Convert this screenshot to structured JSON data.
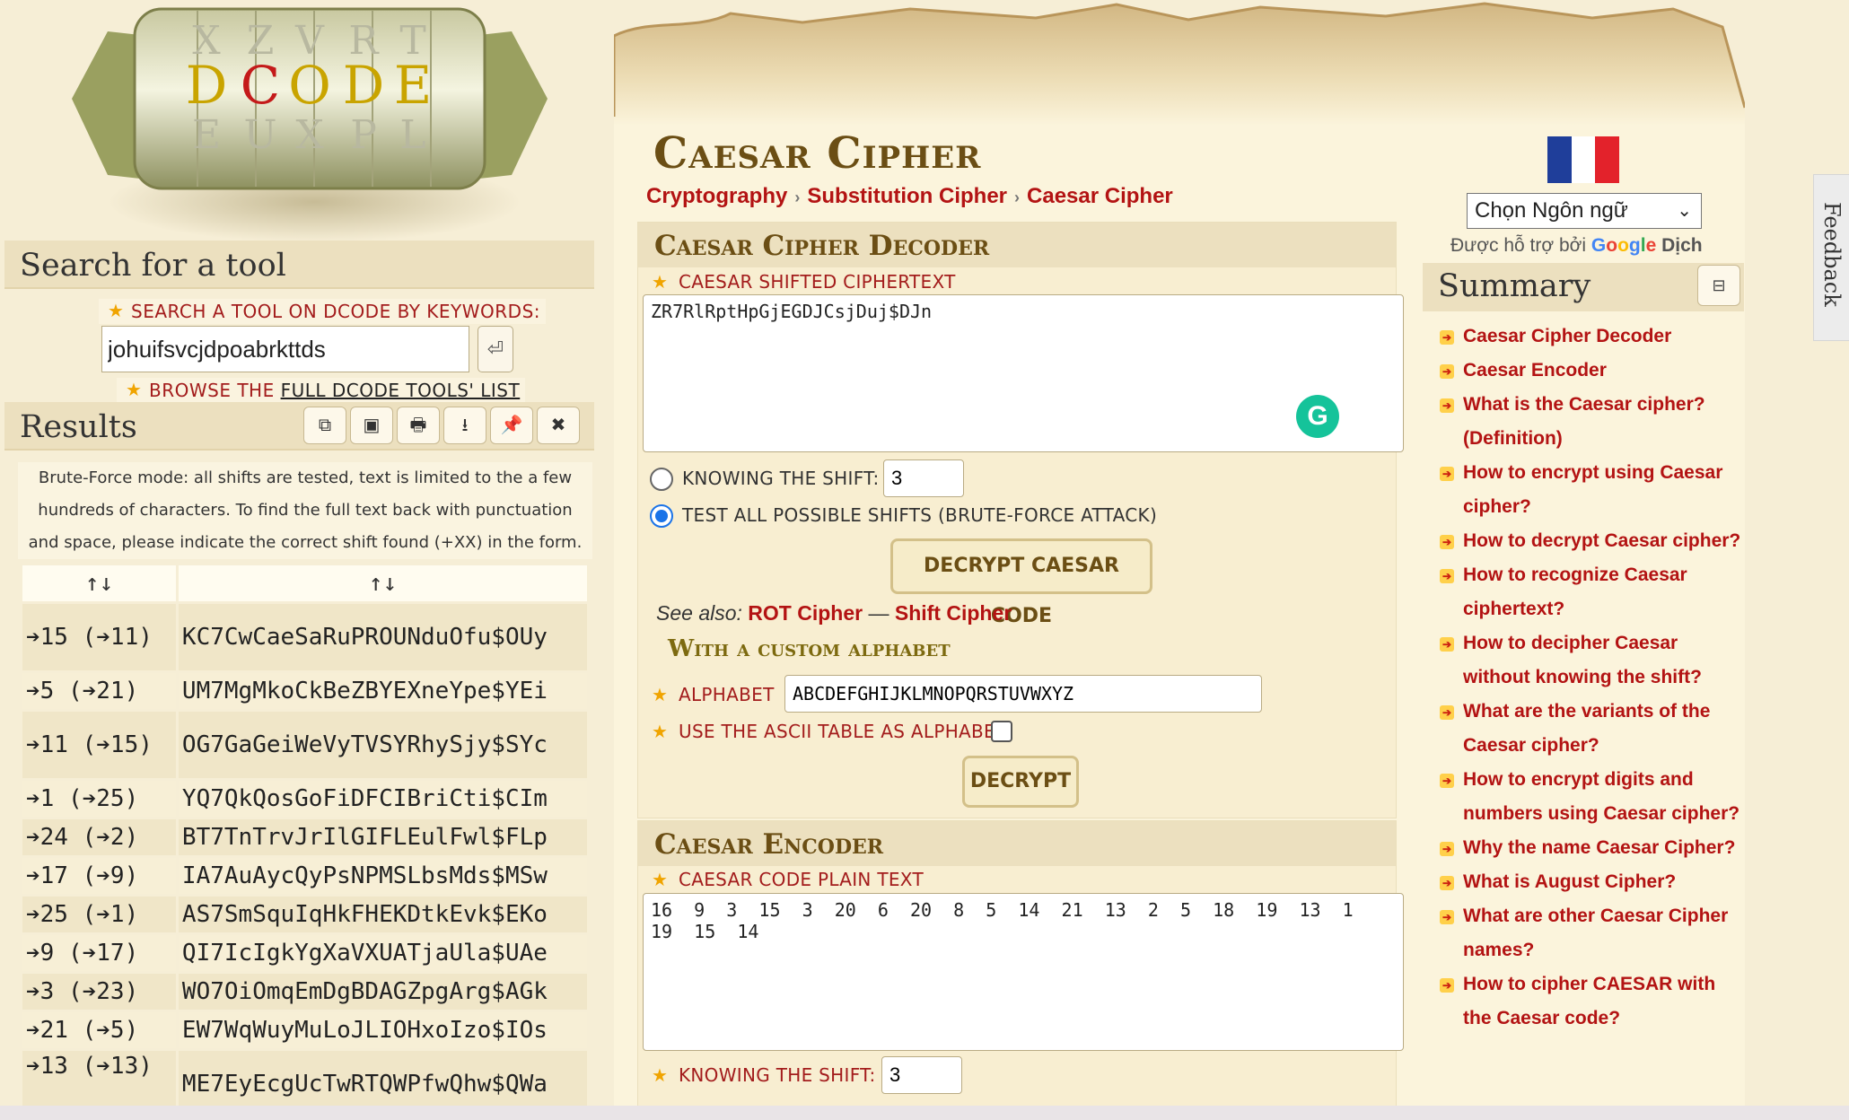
{
  "logo": {
    "letters_top": [
      "X",
      "Z",
      "V",
      "R",
      "T"
    ],
    "letters_mid": [
      "D",
      "C",
      "O",
      "D",
      "E"
    ],
    "letters_bot": [
      "E",
      "U",
      "X",
      "P",
      "L"
    ]
  },
  "left": {
    "search_heading": "Search for a tool",
    "search_label": "SEARCH A TOOL ON DCODE BY KEYWORDS:",
    "search_value": "johuifsvcjdpoabrkttds",
    "enter_icon": "⏎",
    "browse_prefix": "BROWSE THE ",
    "browse_link": "FULL DCODE TOOLS' LIST",
    "results_heading": "Results",
    "toolbar_icons": [
      "⧉",
      "▣",
      "🖶",
      "⭳",
      "📌",
      "✖"
    ],
    "brute_note": "Brute-Force mode: all shifts are tested, text is limited to the a few hundreds of characters. To find the full text back with punctuation and space, please indicate the correct shift found (+XX) in the form.",
    "table_headers": [
      "↑↓",
      "↑↓"
    ],
    "rows": [
      {
        "shift": "➔15 (➔11)",
        "text": "KC7CwCaeSaRuPROUNduOfu$OUy"
      },
      {
        "shift": "➔5 (➔21)",
        "text": "UM7MgMkoCkBeZBYEXneYpe$YEi"
      },
      {
        "shift": "➔11 (➔15)",
        "text": "OG7GaGeiWeVyTVSYRhySjy$SYc"
      },
      {
        "shift": "➔1 (➔25)",
        "text": "YQ7QkQosGoFiDFCIBriCti$CIm"
      },
      {
        "shift": "➔24 (➔2)",
        "text": "BT7TnTrvJrIlGIFLEulFwl$FLp"
      },
      {
        "shift": "➔17 (➔9)",
        "text": "IA7AuAycQyPsNPMSLbsMds$MSw"
      },
      {
        "shift": "➔25 (➔1)",
        "text": "AS7SmSquIqHkFHEKDtkEvk$EKo"
      },
      {
        "shift": "➔9 (➔17)",
        "text": "QI7IcIgkYgXaVXUATjaUla$UAe"
      },
      {
        "shift": "➔3 (➔23)",
        "text": "WO7OiOmqEmDgBDAGZpgArg$AGk"
      },
      {
        "shift": "➔21 (➔5)",
        "text": "EW7WqWuyMuLoJLIOHxoIzo$IOs"
      },
      {
        "shift": "➔13 (➔13)",
        "text": "ME7EyEcgUcTwRTQWPfwQhw$QWa"
      }
    ]
  },
  "main": {
    "title": "Caesar Cipher",
    "breadcrumb": [
      "Cryptography",
      "Substitution Cipher",
      "Caesar Cipher"
    ],
    "decoder": {
      "heading": "Caesar Cipher Decoder",
      "ciphertext_label": "CAESAR SHIFTED CIPHERTEXT",
      "ciphertext_value": "ZR7RlRptHpGjEGDJCsjDuj$DJn",
      "knowing_shift_label": "KNOWING THE SHIFT:",
      "shift_value": "3",
      "brute_label": "TEST ALL POSSIBLE SHIFTS (BRUTE-FORCE ATTACK)",
      "decrypt_button": "DECRYPT CAESAR CODE",
      "see_also_label": "See also:",
      "see_also_links": [
        "ROT Cipher",
        "Shift Cipher"
      ],
      "see_also_sep": "—",
      "custom_heading": "With a custom alphabet",
      "alphabet_label": "ALPHABET",
      "alphabet_value": "ABCDEFGHIJKLMNOPQRSTUVWXYZ",
      "ascii_label": "USE THE ASCII TABLE AS ALPHABET",
      "decrypt2_button": "DECRYPT"
    },
    "encoder": {
      "heading": "Caesar Encoder",
      "plaintext_label": "CAESAR CODE PLAIN TEXT",
      "plaintext_value": "16  9  3  15  3  20  6  20  8  5  14  21  13  2  5  18  19  13  1  19  15  14",
      "knowing_shift_label": "KNOWING THE SHIFT:",
      "shift_value": "3"
    },
    "grammarly_icon": "G"
  },
  "sidebar": {
    "language_select": "Chọn Ngôn ngữ",
    "powered_prefix": "Được hỗ trợ bởi",
    "google": "Google",
    "translate": "Dịch",
    "summary_heading": "Summary",
    "summary_toggle": "⊟",
    "summary_items": [
      "Caesar Cipher Decoder",
      "Caesar Encoder",
      "What is the Caesar cipher? (Definition)",
      "How to encrypt using Caesar cipher?",
      "How to decrypt Caesar cipher?",
      "How to recognize Caesar ciphertext?",
      "How to decipher Caesar without knowing the shift?",
      "What are the variants of the Caesar cipher?",
      "How to encrypt digits and numbers using Caesar cipher?",
      "Why the name Caesar Cipher?",
      "What is August Cipher?",
      "What are other Caesar Cipher names?",
      "How to cipher CAESAR with the Caesar code?"
    ]
  },
  "feedback_label": "Feedback",
  "colors": {
    "accent_red": "#b31313",
    "heading_brown": "#6b4e14",
    "background": "#f6eed6",
    "flag_blue": "#1f3e9a",
    "flag_red": "#e3222b"
  }
}
